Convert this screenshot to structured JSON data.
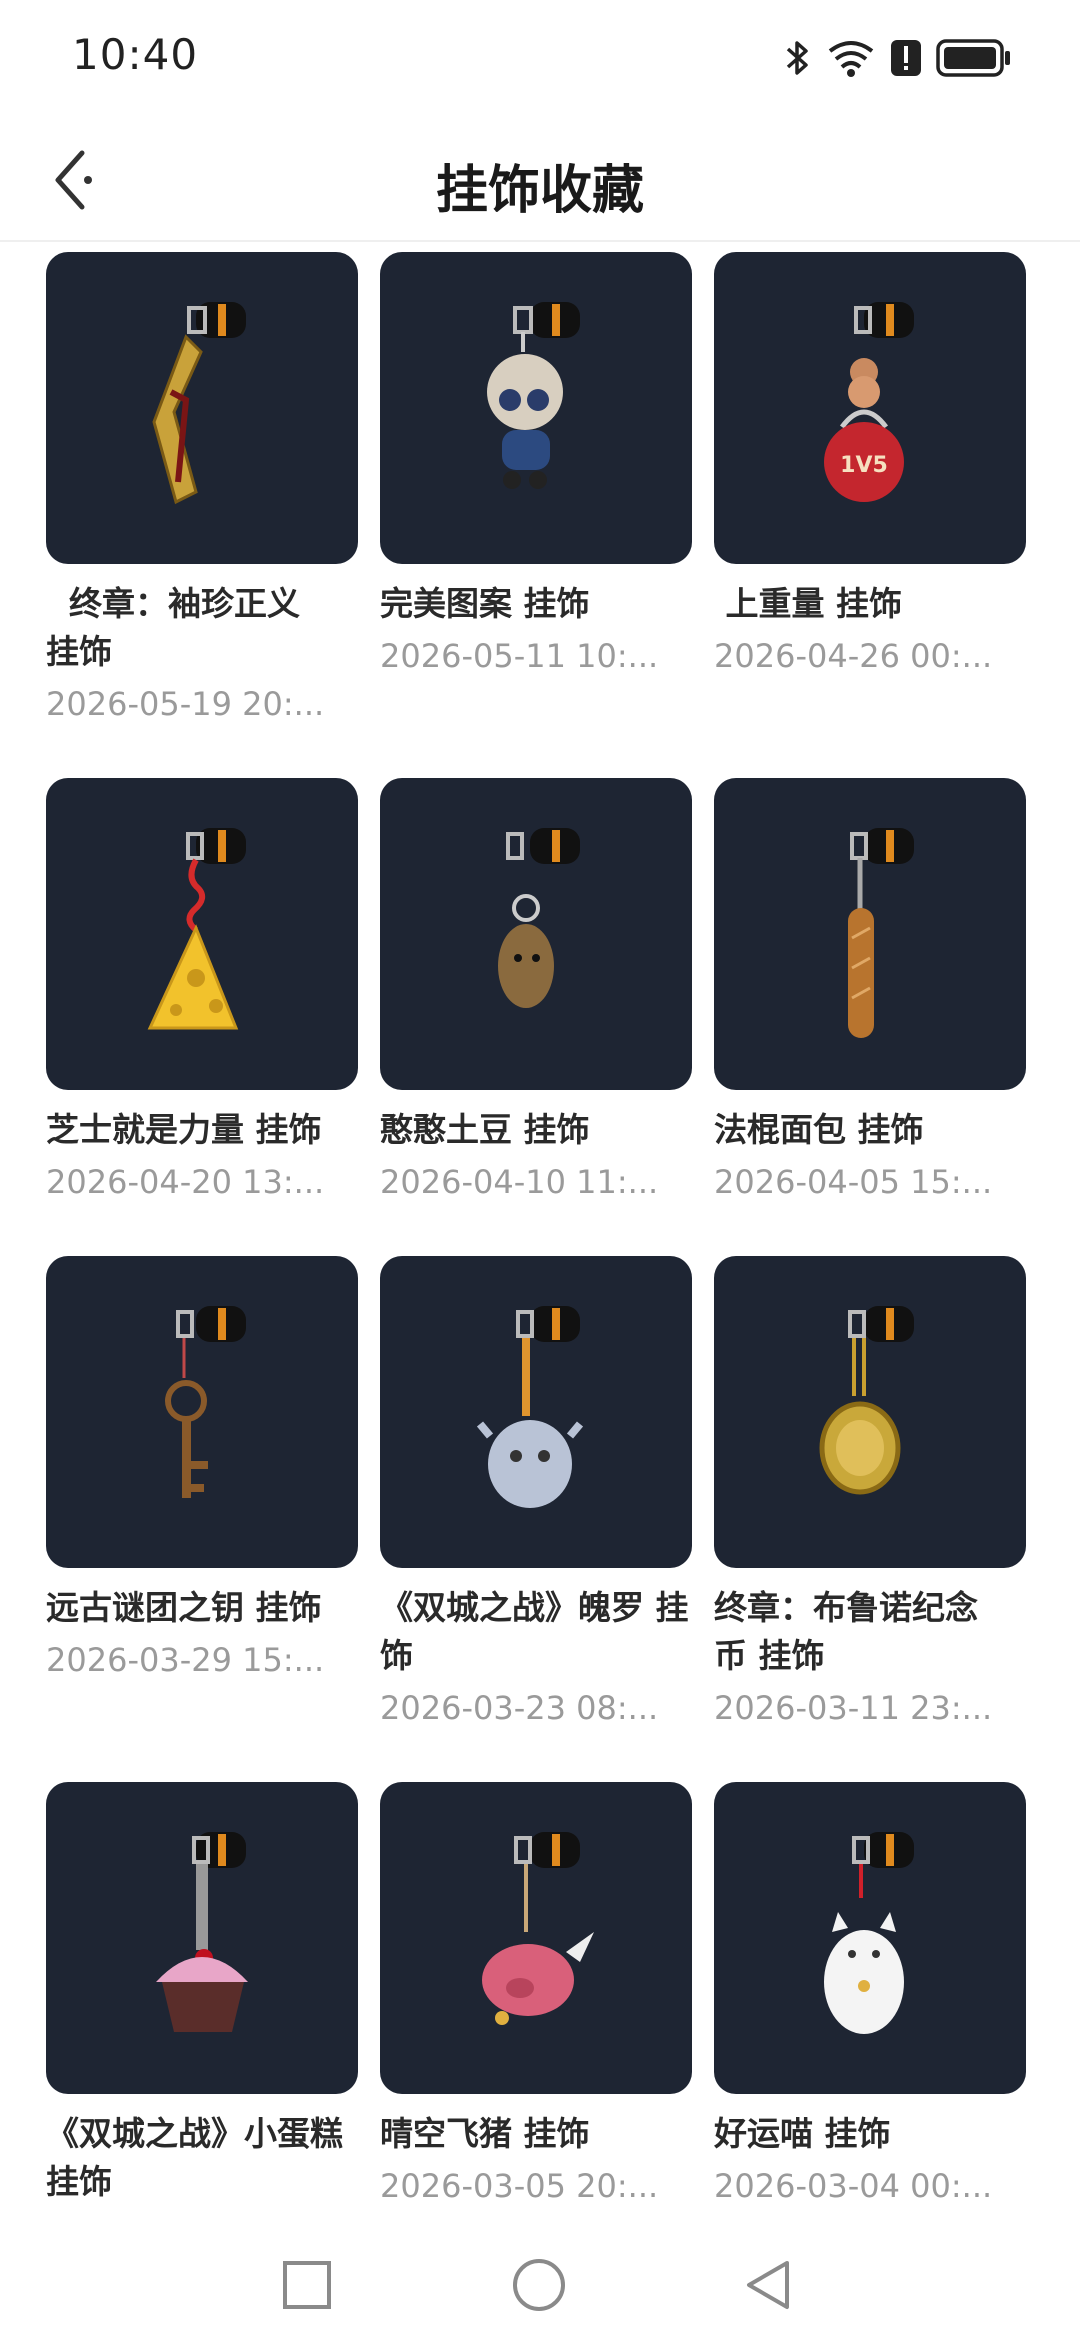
{
  "status": {
    "time": "10:40",
    "icons": [
      "bluetooth-icon",
      "wifi-icon",
      "alert-icon",
      "battery-icon"
    ]
  },
  "header": {
    "title": "挂饰收藏",
    "back_icon": "back-arrow-icon"
  },
  "colors": {
    "card_bg": "#1e2533",
    "title": "#1a1a1a",
    "date": "#9a9a9a"
  },
  "items": [
    {
      "name": "  终章：袖珍正义\n挂饰",
      "date": "2026-05-19 20:..."
    },
    {
      "name": "完美图案 挂饰",
      "date": "2026-05-11 10:..."
    },
    {
      "name": " 上重量 挂饰",
      "date": "2026-04-26 00:..."
    },
    {
      "name": "芝士就是力量 挂饰",
      "date": "2026-04-20 13:..."
    },
    {
      "name": "憨憨土豆 挂饰",
      "date": "2026-04-10 11:..."
    },
    {
      "name": "法棍面包 挂饰",
      "date": "2026-04-05 15:..."
    },
    {
      "name": "远古谜团之钥 挂饰",
      "date": "2026-03-29 15:..."
    },
    {
      "name": "《双城之战》魄罗 挂\n饰",
      "date": "2026-03-23 08:..."
    },
    {
      "name": "终章：布鲁诺纪念\n币 挂饰",
      "date": "2026-03-11 23:..."
    },
    {
      "name": "《双城之战》小蛋糕\n挂饰",
      "date": ""
    },
    {
      "name": "晴空飞猪 挂饰",
      "date": "2026-03-05 20:..."
    },
    {
      "name": "好运喵 挂饰",
      "date": "2026-03-04 00:..."
    }
  ],
  "navbar": {
    "buttons": [
      "recent-apps-icon",
      "home-icon",
      "back-icon"
    ]
  }
}
